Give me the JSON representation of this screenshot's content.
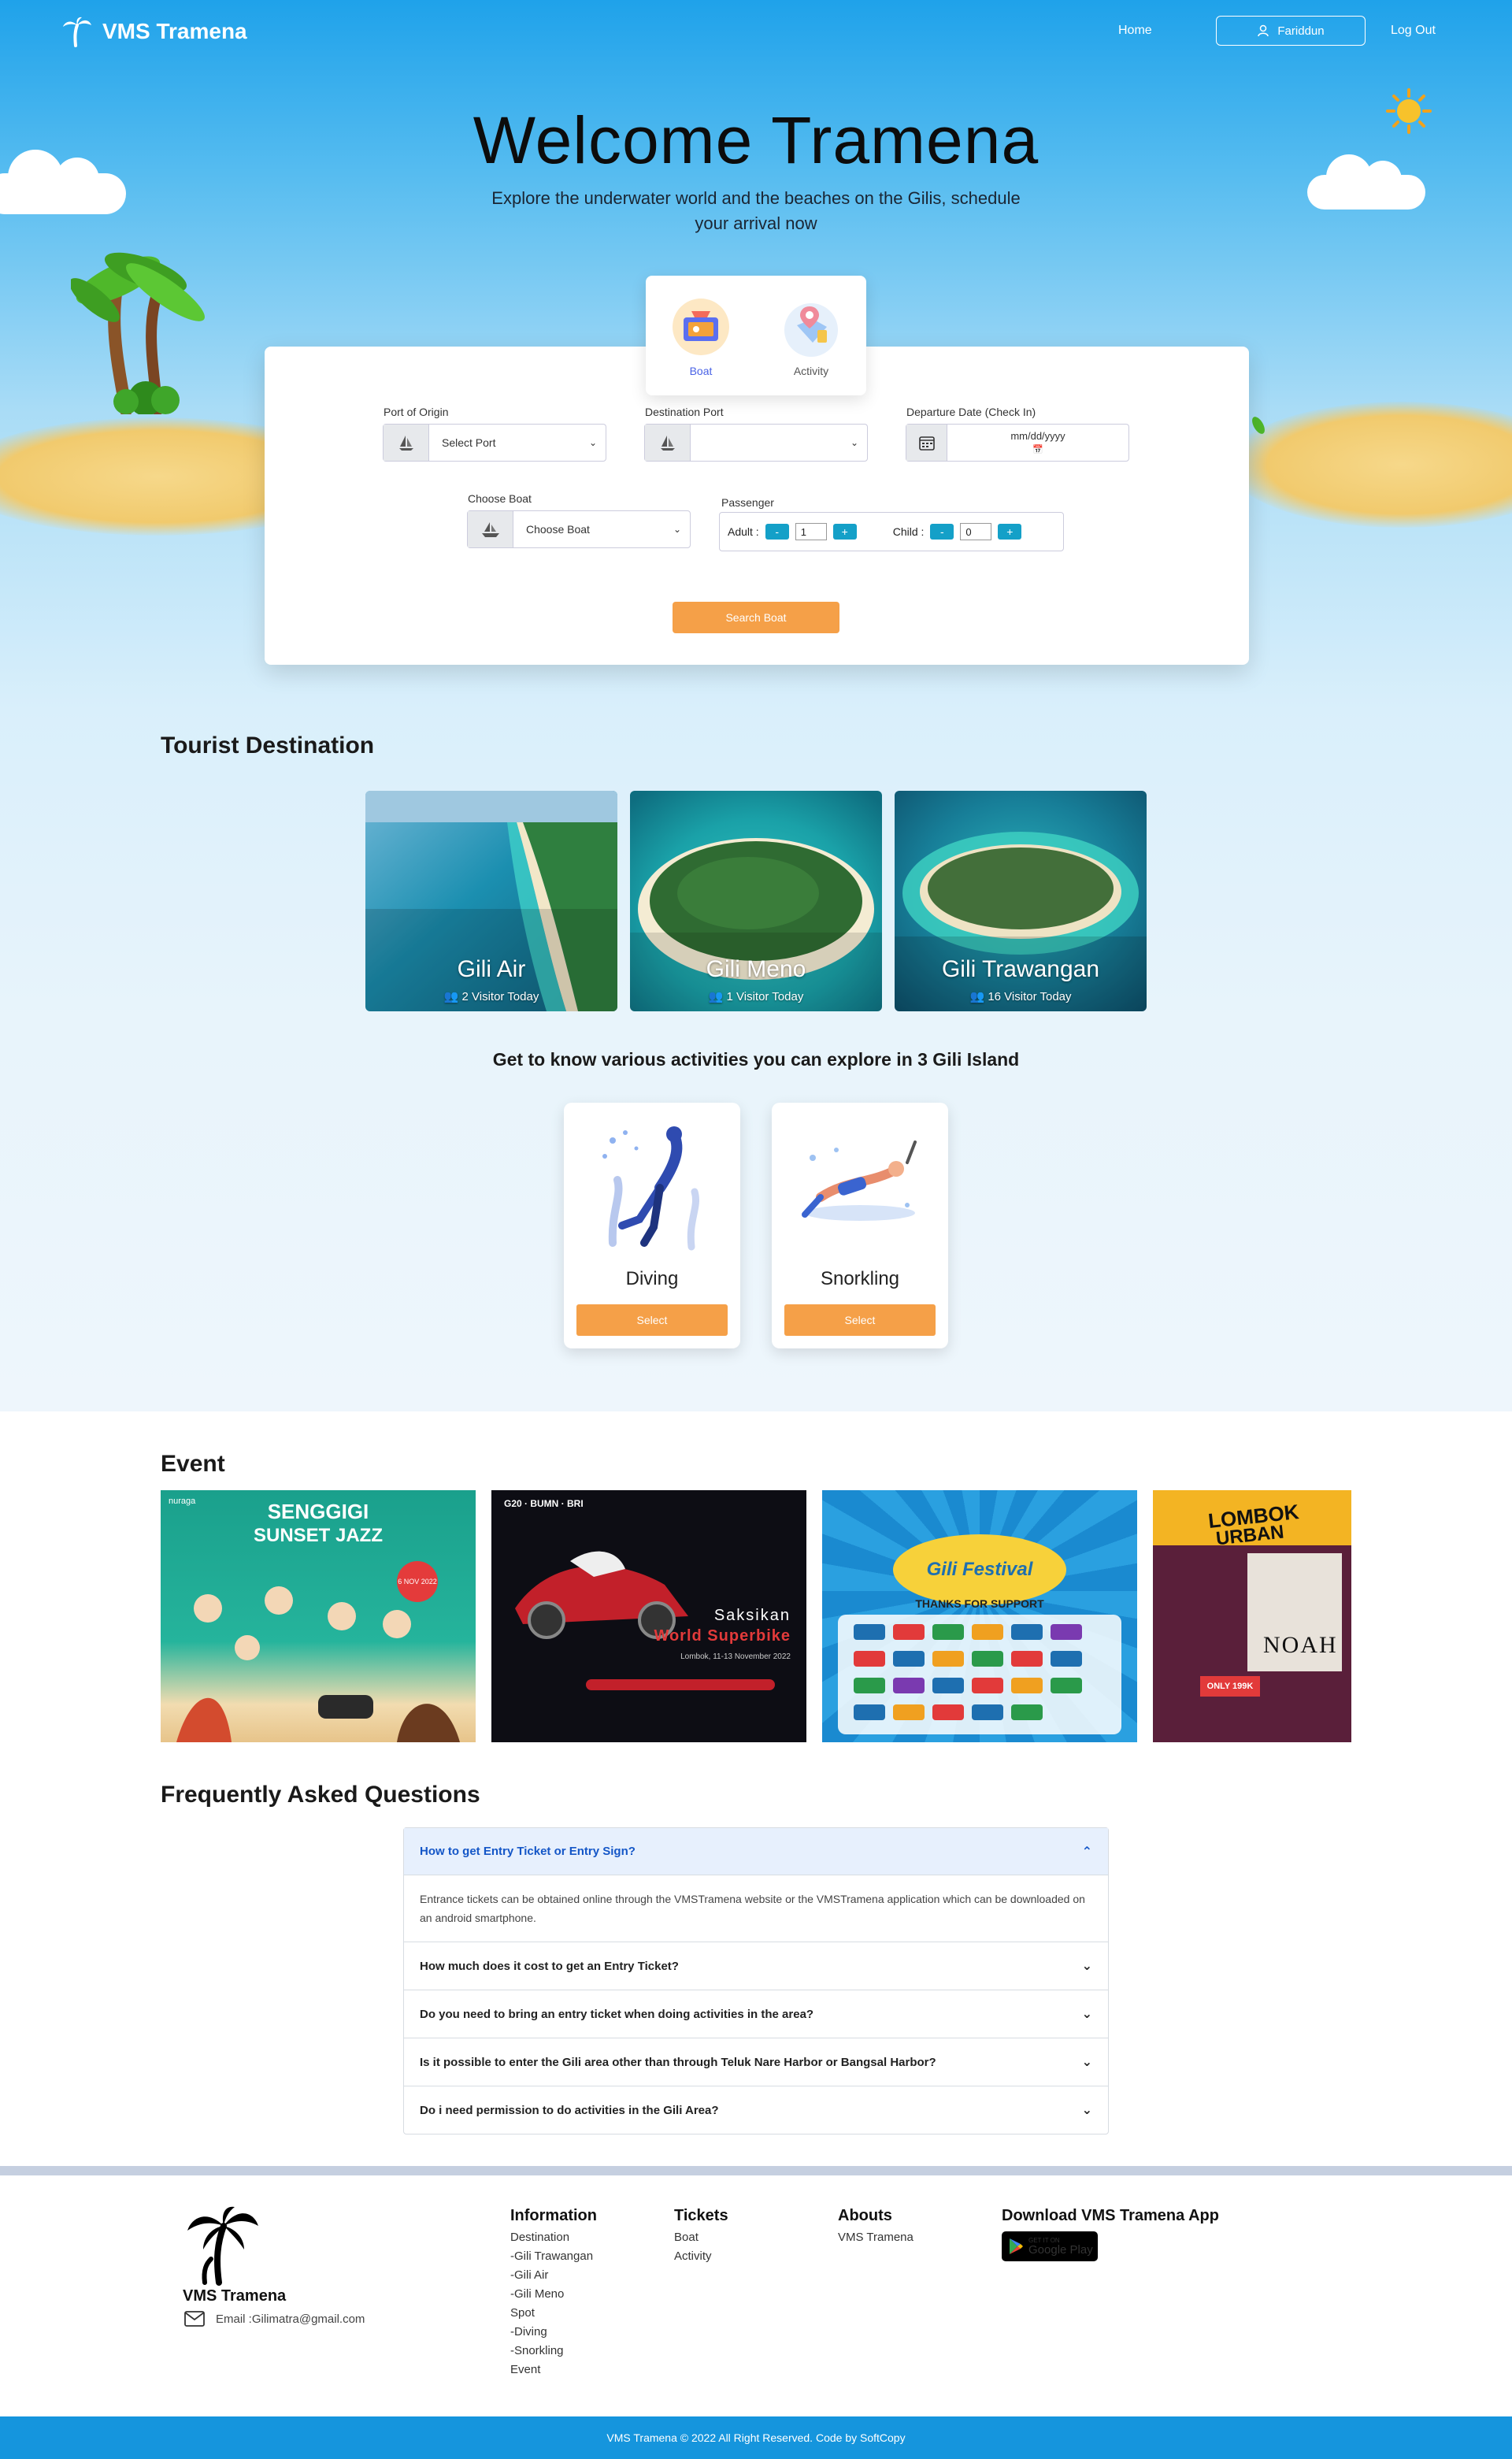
{
  "nav": {
    "brand": "VMS Tramena",
    "home": "Home",
    "user": "Fariddun",
    "logout": "Log Out"
  },
  "hero": {
    "title": "Welcome Tramena",
    "subtitle": "Explore the underwater world and the beaches on the Gilis, schedule your arrival now"
  },
  "services": [
    {
      "label": "Boat",
      "icon": "boat-booking-icon"
    },
    {
      "label": "Activity",
      "icon": "activity-map-icon"
    }
  ],
  "search": {
    "origin_label": "Port of Origin",
    "origin_value": "Select Port",
    "destination_label": "Destination Port",
    "destination_value": "",
    "date_label": "Departure Date (Check In)",
    "date_placeholder": "mm/dd/yyyy",
    "boat_label": "Choose Boat",
    "boat_value": "Choose Boat",
    "passenger_label": "Passenger",
    "adult_label": "Adult :",
    "adult_value": "1",
    "child_label": "Child :",
    "child_value": "0",
    "minus": "-",
    "plus": "+",
    "button": "Search Boat"
  },
  "destinations": {
    "title": "Tourist Destination",
    "items": [
      {
        "name": "Gili Air",
        "visitors": "2 Visitor Today"
      },
      {
        "name": "Gili Meno",
        "visitors": "1 Visitor Today"
      },
      {
        "name": "Gili Trawangan",
        "visitors": "16 Visitor Today"
      }
    ]
  },
  "activities": {
    "title": "Get to know various activities you can explore in 3 Gili Island",
    "items": [
      {
        "name": "Diving",
        "button": "Select"
      },
      {
        "name": "Snorkling",
        "button": "Select"
      }
    ]
  },
  "events": {
    "title": "Event",
    "posters": [
      {
        "line1": "SENGGIGI",
        "line2": "SUNSET JAZZ",
        "tag": "6 NOV 2022",
        "brand": "nuraga"
      },
      {
        "line1": "Saksikan",
        "line2": "World Superbike",
        "tag": "Lombok, 11-13 November 2022",
        "brand": "G20 · BUMN · BRI"
      },
      {
        "line1": "Gili Festival",
        "line2": "THANKS FOR SUPPORT",
        "tag": "",
        "brand": ""
      },
      {
        "line1": "LOMBOK",
        "line2": "URBAN",
        "tag": "ONLY 199K",
        "brand": "NOAH"
      }
    ]
  },
  "faq": {
    "title": "Frequently Asked Questions",
    "items": [
      {
        "q": "How to get Entry Ticket or Entry Sign?",
        "a": "Entrance tickets can be obtained online through the VMSTramena website or the VMSTramena application which can be downloaded on an android smartphone."
      },
      {
        "q": "How much does it cost to get an Entry Ticket?"
      },
      {
        "q": "Do you need to bring an entry ticket when doing activities in the area?"
      },
      {
        "q": "Is it possible to enter the Gili area other than through Teluk Nare Harbor or Bangsal Harbor?"
      },
      {
        "q": "Do i need permission to do activities in the Gili Area?"
      }
    ]
  },
  "footer": {
    "brand": "VMS Tramena",
    "email": "Email :Gilimatra@gmail.com",
    "information": {
      "title": "Information",
      "links": [
        "Destination",
        "-Gili Trawangan",
        "-Gili Air",
        "-Gili Meno",
        "Spot",
        "-Diving",
        "-Snorkling",
        "Event"
      ]
    },
    "tickets": {
      "title": "Tickets",
      "links": [
        "Boat",
        "Activity"
      ]
    },
    "abouts": {
      "title": "Abouts",
      "links": [
        "VMS Tramena"
      ]
    },
    "download": {
      "title": "Download VMS Tramena App",
      "badge_small": "GET IT ON",
      "badge_big": "Google Play"
    },
    "copyright": "VMS Tramena © 2022 All Right Reserved. Code by SoftCopy"
  },
  "colors": {
    "sky_top": "#1fa2ea",
    "accent_orange": "#f5a048",
    "stepper_teal": "#14a0c8",
    "faq_open_text": "#1456c7",
    "footer_bar": "#1595dd"
  }
}
